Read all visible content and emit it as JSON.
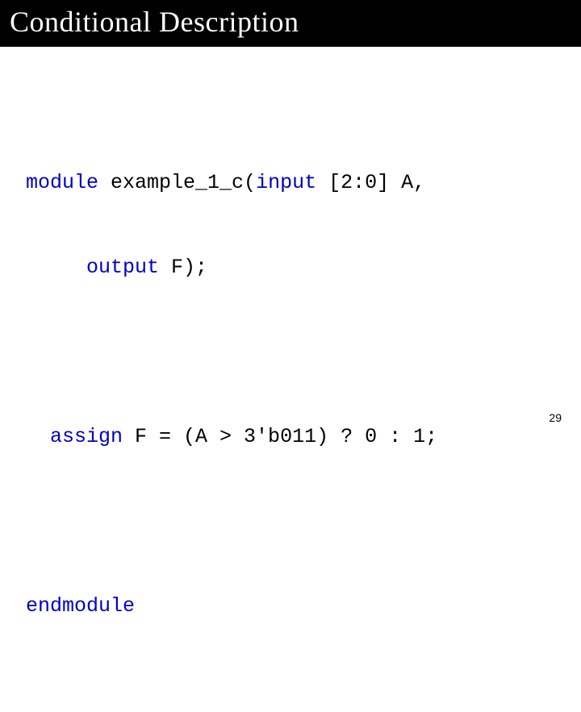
{
  "title": "Conditional Description",
  "code": {
    "line1_kw1": "module",
    "line1_rest": " example_1_c(",
    "line1_kw2": "input",
    "line1_tail": " [2:0] A,",
    "line2_indent": "     ",
    "line2_kw": "output",
    "line2_tail": " F);",
    "line3_indent": "  ",
    "line3_kw": "assign",
    "line3_tail": " F = (A > 3'b011) ? 0 : 1;",
    "line4_kw": "endmodule"
  },
  "page_number": "29"
}
